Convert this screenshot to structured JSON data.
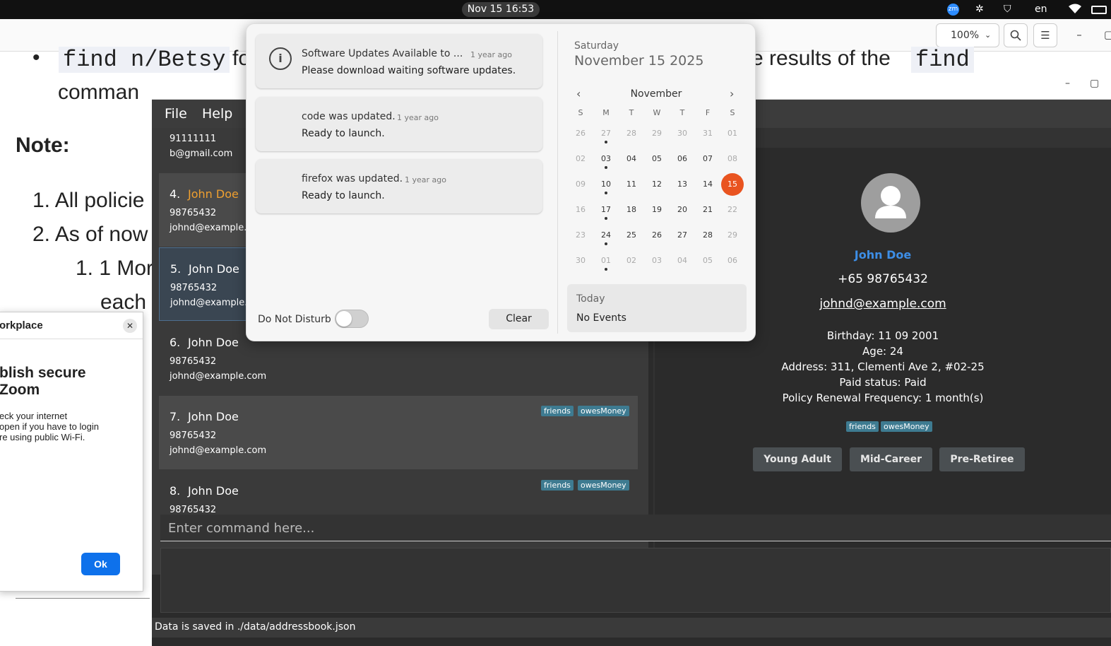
{
  "topbar": {
    "clock": "Nov 15  16:53",
    "language": "en",
    "icons": [
      "zoom-icon",
      "network-icon",
      "shield-icon",
      "wifi-icon",
      "battery-icon"
    ]
  },
  "doc_viewer": {
    "zoom_level": "100%",
    "line1_code": "find n/Betsy",
    "line1_mid": "fo",
    "line1_right": "e results of the",
    "line1_code2": "find",
    "line2": "comman",
    "note_heading": "Note:",
    "item1": "1. All policie",
    "item2": "2. As of now",
    "subitem1": "1. 1 Mor",
    "subitem1b": "each"
  },
  "zoom_dialog": {
    "title": "orkplace",
    "heading": "blish secure\nZoom",
    "body": "eck your internet\nopen if you have to login\nre using public Wi-Fi.",
    "ok_label": "Ok"
  },
  "app": {
    "menu": {
      "file": "File",
      "help": "Help"
    },
    "persons": [
      {
        "index": "",
        "name": "",
        "phone": "91111111",
        "email": "b@gmail.com",
        "tags": []
      },
      {
        "index": "4.",
        "name": "John Doe",
        "phone": "98765432",
        "email": "johnd@example.",
        "tags": []
      },
      {
        "index": "5.",
        "name": "John Doe",
        "phone": "98765432",
        "email": "johnd@example.",
        "tags": []
      },
      {
        "index": "6.",
        "name": "John Doe",
        "phone": "98765432",
        "email": "johnd@example.com",
        "tags": []
      },
      {
        "index": "7.",
        "name": "John Doe",
        "phone": "98765432",
        "email": "johnd@example.com",
        "tags": [
          "friends",
          "owesMoney"
        ]
      },
      {
        "index": "8.",
        "name": "John Doe",
        "phone": "98765432",
        "email": "",
        "tags": [
          "friends",
          "owesMoney"
        ]
      }
    ],
    "detail": {
      "name": "John Doe",
      "phone": "+65 98765432",
      "email": "johnd@example.com",
      "birthday": "Birthday: 11 09 2001",
      "age": "Age: 24",
      "address": "Address: 311, Clementi Ave 2, #02-25",
      "paid": "Paid status: Paid",
      "renewal": "Policy Renewal Frequency: 1 month(s)",
      "tags": [
        "friends",
        "owesMoney"
      ],
      "groups": [
        "Young Adult",
        "Mid-Career",
        "Pre-Retiree"
      ]
    },
    "command_placeholder": "Enter command here...",
    "status": "Data is saved in ./data/addressbook.json",
    "accent_name_color": "#f0a030",
    "detail_name_color": "#3d8ee6"
  },
  "notifications": {
    "items": [
      {
        "title": "Software Updates Available to ...",
        "time": "1 year ago",
        "body": "Please download waiting software updates."
      },
      {
        "title": "code was updated.",
        "time": "1 year ago",
        "body": "Ready to launch."
      },
      {
        "title": "firefox was updated.",
        "time": "1 year ago",
        "body": "Ready to launch."
      }
    ],
    "dnd_label": "Do Not Disturb",
    "clear_label": "Clear"
  },
  "calendar": {
    "weekday": "Saturday",
    "date": "November 15 2025",
    "month": "November",
    "dow": [
      "S",
      "M",
      "T",
      "W",
      "T",
      "F",
      "S"
    ],
    "weeks": [
      [
        "26",
        "27",
        "28",
        "29",
        "30",
        "31",
        "01"
      ],
      [
        "02",
        "03",
        "04",
        "05",
        "06",
        "07",
        "08"
      ],
      [
        "09",
        "10",
        "11",
        "12",
        "13",
        "14",
        "15"
      ],
      [
        "16",
        "17",
        "18",
        "19",
        "20",
        "21",
        "22"
      ],
      [
        "23",
        "24",
        "25",
        "26",
        "27",
        "28",
        "29"
      ],
      [
        "30",
        "01",
        "02",
        "03",
        "04",
        "05",
        "06"
      ]
    ],
    "today_label": "Today",
    "events_label": "No Events",
    "today_color": "#e95420"
  }
}
